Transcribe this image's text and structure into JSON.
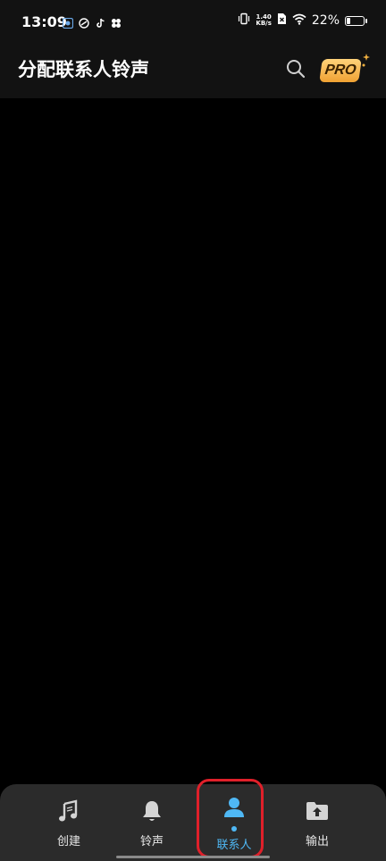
{
  "status_bar": {
    "time": "13:09",
    "net_speed_value": "1.40",
    "net_speed_unit": "KB/s",
    "battery_percent": "22%",
    "battery_level": 0.22
  },
  "header": {
    "title": "分配联系人铃声",
    "pro_label": "PRO"
  },
  "bottom_nav": {
    "items": [
      {
        "label": "创建",
        "icon": "music-note-icon",
        "active": false
      },
      {
        "label": "铃声",
        "icon": "bell-icon",
        "active": false
      },
      {
        "label": "联系人",
        "icon": "person-icon",
        "active": true
      },
      {
        "label": "输出",
        "icon": "folder-upload-icon",
        "active": false
      }
    ]
  },
  "colors": {
    "accent": "#4fb8f5",
    "pro_gold": "#f0a233",
    "highlight": "#e0202a"
  }
}
